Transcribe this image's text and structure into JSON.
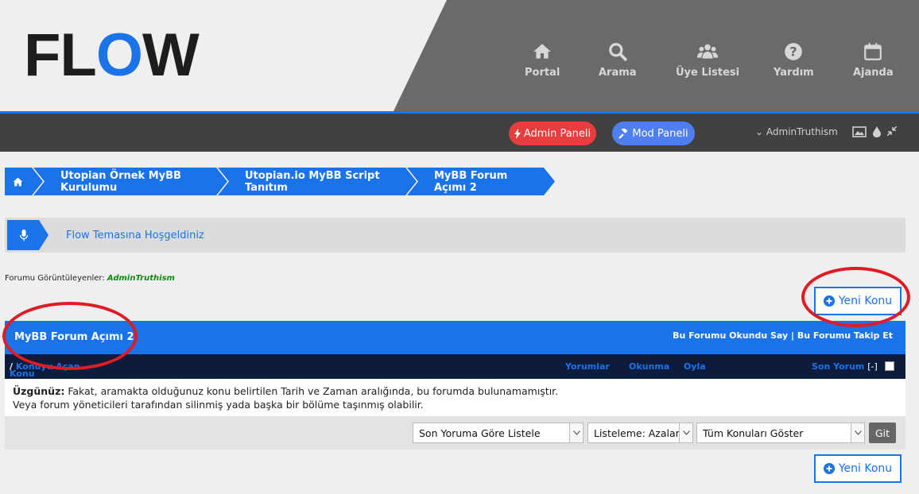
{
  "logo": {
    "pre": "FL",
    "o": "O",
    "post": "W"
  },
  "nav": [
    {
      "label": "Portal",
      "icon": "home-icon"
    },
    {
      "label": "Arama",
      "icon": "search-icon"
    },
    {
      "label": "Üye Listesi",
      "icon": "users-icon"
    },
    {
      "label": "Yardım",
      "icon": "help-icon"
    },
    {
      "label": "Ajanda",
      "icon": "calendar-icon"
    }
  ],
  "toolbar": {
    "admin_label": "Admin Paneli",
    "mod_label": "Mod Paneli",
    "username": "AdminTruthism"
  },
  "breadcrumb": [
    "Utopian Örnek MyBB Kurulumu",
    "Utopian.io MyBB Script Tanıtım",
    "MyBB Forum Açımı 2"
  ],
  "welcome": "Flow Temasına Hoşgeldiniz",
  "viewers": {
    "label": "Forumu Görüntüleyenler:",
    "user": "AdminTruthism"
  },
  "new_thread_label": "Yeni Konu",
  "forum": {
    "title": "MyBB Forum Açımı 2",
    "mark_read": "Bu Forumu Okundu Say",
    "separator": "|",
    "subscribe": "Bu Forumu Takip Et"
  },
  "columns": {
    "topic": "Konu",
    "slash": "/",
    "author": "Konuyu Açan",
    "replies": "Yorumlar",
    "views": "Okunma",
    "rating": "Oyla",
    "last_post": "Son Yorum",
    "sort_marker": "[-]"
  },
  "message": {
    "bold": "Üzgünüz:",
    "line1": "Fakat, aramakta olduğunuz konu belirtilen Tarih ve Zaman aralığında, bu forumda bulunamamıştır.",
    "line2": "Veya forum yöneticileri tarafından silinmiş yada başka bir bölüme taşınmış olabilir."
  },
  "filters": {
    "sort_by": "Son Yoruma Göre Listele",
    "order": "Listeleme: Azalan",
    "range": "Tüm Konuları Göster",
    "go": "Git"
  },
  "colors": {
    "accent": "#1a73e8",
    "admin": "#e63d3d",
    "mod": "#4e7ef0",
    "annotation": "#e01b24"
  }
}
